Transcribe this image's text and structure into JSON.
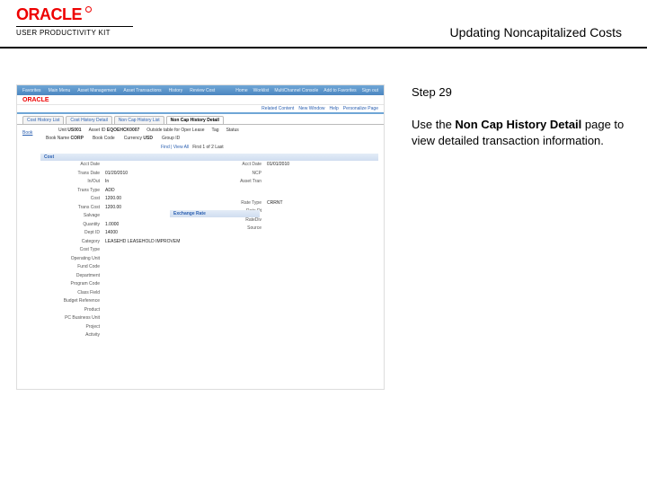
{
  "header": {
    "logo_text": "ORACLE",
    "upk_text": "USER PRODUCTIVITY KIT",
    "page_title": "Updating Noncapitalized Costs"
  },
  "instruction": {
    "step_label": "Step 29",
    "text_pre": "Use the ",
    "bold": "Non Cap History Detail",
    "text_post": " page to view detailed transaction information."
  },
  "screenshot": {
    "topnav": {
      "left": [
        "Favorites",
        "Main Menu",
        "Asset Management",
        "Asset Transactions",
        "History",
        "Review Cost"
      ],
      "right": [
        "Home",
        "Worklist",
        "MultiChannel Console",
        "Add to Favorites",
        "Sign out"
      ]
    },
    "midrow": [
      "Related Content",
      "New Window",
      "Help",
      "Personalize Page"
    ],
    "tabs": [
      {
        "label": "Cost History List",
        "active": false
      },
      {
        "label": "Cost History Detail",
        "active": false
      },
      {
        "label": "Non Cap History List",
        "active": false
      },
      {
        "label": "Non Cap History Detail",
        "active": true
      }
    ],
    "back_label": "Book",
    "info1": [
      {
        "k": "Unit",
        "v": "US001"
      },
      {
        "k": "Asset ID",
        "v": "EQOEHCK0007"
      },
      {
        "k": "Outside table for Oper Lease",
        "v": ""
      },
      {
        "k": "Tag",
        "v": ""
      },
      {
        "k": "Status",
        "v": ""
      }
    ],
    "info2": [
      {
        "k": "Book Name",
        "v": "CORP"
      },
      {
        "k": "Book Code",
        "v": ""
      },
      {
        "k": "Currency",
        "v": "USD"
      },
      {
        "k": "Group ID",
        "v": ""
      }
    ],
    "find": {
      "label": "Book",
      "find": "Find | View All",
      "nav": "First 1 of 2 Last"
    },
    "section_left": "Cost",
    "section_right": "Exchange Rate",
    "left_rows": [
      {
        "k": "Acct Date",
        "v": ""
      },
      {
        "k": "Trans Date",
        "v": "01/20/2010"
      },
      {
        "k": "In/Out",
        "v": "In"
      },
      {
        "k": "Trans Type",
        "v": "ADD"
      },
      {
        "k": "Cost",
        "v": "1200.00"
      },
      {
        "k": "Trans Cost",
        "v": "1200.00"
      },
      {
        "k": "Salvage",
        "v": ""
      },
      {
        "k": "Quantity",
        "v": "1.0000"
      },
      {
        "k": "Dept ID",
        "v": "14000"
      },
      {
        "k": "Category",
        "v": "LEASEHD   LEASEHOLD IMPROVEM"
      },
      {
        "k": "Cost Type",
        "v": ""
      },
      {
        "k": "Operating Unit",
        "v": ""
      },
      {
        "k": "Fund Code",
        "v": ""
      },
      {
        "k": "Department",
        "v": ""
      },
      {
        "k": "Program Code",
        "v": ""
      },
      {
        "k": "Class Field",
        "v": ""
      },
      {
        "k": "Budget Reference",
        "v": ""
      },
      {
        "k": "Product",
        "v": ""
      },
      {
        "k": "PC Business Unit",
        "v": ""
      },
      {
        "k": "Project",
        "v": ""
      },
      {
        "k": "Activity",
        "v": ""
      }
    ],
    "right_rows": [
      {
        "k": "Acct Date",
        "v": "01/01/2010"
      },
      {
        "k": "",
        "v": ""
      },
      {
        "k": "NCP",
        "v": ""
      },
      {
        "k": "Asset Tran",
        "v": ""
      },
      {
        "k": "",
        "v": ""
      },
      {
        "k": "",
        "v": ""
      },
      {
        "k": "Rate Type",
        "v": "CRRNT"
      },
      {
        "k": "Rate Dt",
        "v": ""
      },
      {
        "k": "RateDiv",
        "v": ""
      },
      {
        "k": "Source",
        "v": ""
      }
    ]
  }
}
